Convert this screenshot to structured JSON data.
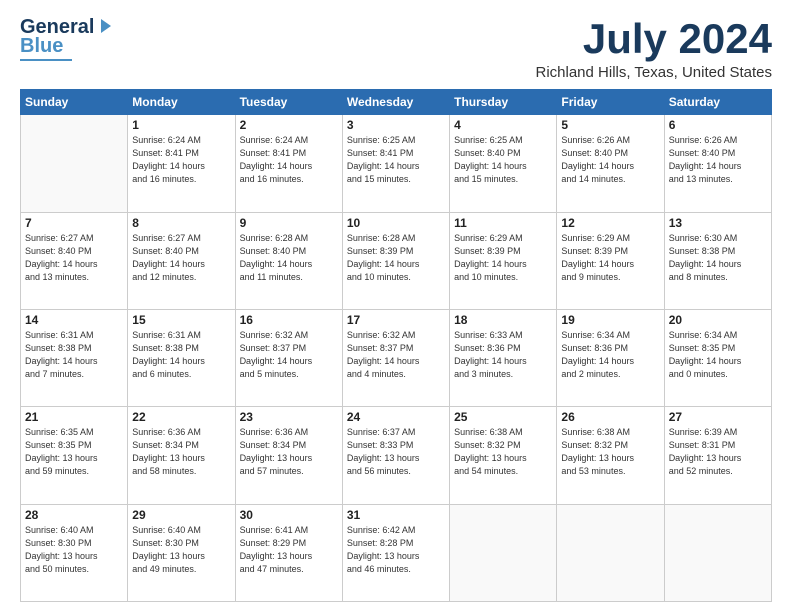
{
  "header": {
    "logo_line1": "General",
    "logo_line2": "Blue",
    "month": "July 2024",
    "location": "Richland Hills, Texas, United States"
  },
  "weekdays": [
    "Sunday",
    "Monday",
    "Tuesday",
    "Wednesday",
    "Thursday",
    "Friday",
    "Saturday"
  ],
  "weeks": [
    [
      {
        "day": "",
        "info": ""
      },
      {
        "day": "1",
        "info": "Sunrise: 6:24 AM\nSunset: 8:41 PM\nDaylight: 14 hours\nand 16 minutes."
      },
      {
        "day": "2",
        "info": "Sunrise: 6:24 AM\nSunset: 8:41 PM\nDaylight: 14 hours\nand 16 minutes."
      },
      {
        "day": "3",
        "info": "Sunrise: 6:25 AM\nSunset: 8:41 PM\nDaylight: 14 hours\nand 15 minutes."
      },
      {
        "day": "4",
        "info": "Sunrise: 6:25 AM\nSunset: 8:40 PM\nDaylight: 14 hours\nand 15 minutes."
      },
      {
        "day": "5",
        "info": "Sunrise: 6:26 AM\nSunset: 8:40 PM\nDaylight: 14 hours\nand 14 minutes."
      },
      {
        "day": "6",
        "info": "Sunrise: 6:26 AM\nSunset: 8:40 PM\nDaylight: 14 hours\nand 13 minutes."
      }
    ],
    [
      {
        "day": "7",
        "info": "Sunrise: 6:27 AM\nSunset: 8:40 PM\nDaylight: 14 hours\nand 13 minutes."
      },
      {
        "day": "8",
        "info": "Sunrise: 6:27 AM\nSunset: 8:40 PM\nDaylight: 14 hours\nand 12 minutes."
      },
      {
        "day": "9",
        "info": "Sunrise: 6:28 AM\nSunset: 8:40 PM\nDaylight: 14 hours\nand 11 minutes."
      },
      {
        "day": "10",
        "info": "Sunrise: 6:28 AM\nSunset: 8:39 PM\nDaylight: 14 hours\nand 10 minutes."
      },
      {
        "day": "11",
        "info": "Sunrise: 6:29 AM\nSunset: 8:39 PM\nDaylight: 14 hours\nand 10 minutes."
      },
      {
        "day": "12",
        "info": "Sunrise: 6:29 AM\nSunset: 8:39 PM\nDaylight: 14 hours\nand 9 minutes."
      },
      {
        "day": "13",
        "info": "Sunrise: 6:30 AM\nSunset: 8:38 PM\nDaylight: 14 hours\nand 8 minutes."
      }
    ],
    [
      {
        "day": "14",
        "info": "Sunrise: 6:31 AM\nSunset: 8:38 PM\nDaylight: 14 hours\nand 7 minutes."
      },
      {
        "day": "15",
        "info": "Sunrise: 6:31 AM\nSunset: 8:38 PM\nDaylight: 14 hours\nand 6 minutes."
      },
      {
        "day": "16",
        "info": "Sunrise: 6:32 AM\nSunset: 8:37 PM\nDaylight: 14 hours\nand 5 minutes."
      },
      {
        "day": "17",
        "info": "Sunrise: 6:32 AM\nSunset: 8:37 PM\nDaylight: 14 hours\nand 4 minutes."
      },
      {
        "day": "18",
        "info": "Sunrise: 6:33 AM\nSunset: 8:36 PM\nDaylight: 14 hours\nand 3 minutes."
      },
      {
        "day": "19",
        "info": "Sunrise: 6:34 AM\nSunset: 8:36 PM\nDaylight: 14 hours\nand 2 minutes."
      },
      {
        "day": "20",
        "info": "Sunrise: 6:34 AM\nSunset: 8:35 PM\nDaylight: 14 hours\nand 0 minutes."
      }
    ],
    [
      {
        "day": "21",
        "info": "Sunrise: 6:35 AM\nSunset: 8:35 PM\nDaylight: 13 hours\nand 59 minutes."
      },
      {
        "day": "22",
        "info": "Sunrise: 6:36 AM\nSunset: 8:34 PM\nDaylight: 13 hours\nand 58 minutes."
      },
      {
        "day": "23",
        "info": "Sunrise: 6:36 AM\nSunset: 8:34 PM\nDaylight: 13 hours\nand 57 minutes."
      },
      {
        "day": "24",
        "info": "Sunrise: 6:37 AM\nSunset: 8:33 PM\nDaylight: 13 hours\nand 56 minutes."
      },
      {
        "day": "25",
        "info": "Sunrise: 6:38 AM\nSunset: 8:32 PM\nDaylight: 13 hours\nand 54 minutes."
      },
      {
        "day": "26",
        "info": "Sunrise: 6:38 AM\nSunset: 8:32 PM\nDaylight: 13 hours\nand 53 minutes."
      },
      {
        "day": "27",
        "info": "Sunrise: 6:39 AM\nSunset: 8:31 PM\nDaylight: 13 hours\nand 52 minutes."
      }
    ],
    [
      {
        "day": "28",
        "info": "Sunrise: 6:40 AM\nSunset: 8:30 PM\nDaylight: 13 hours\nand 50 minutes."
      },
      {
        "day": "29",
        "info": "Sunrise: 6:40 AM\nSunset: 8:30 PM\nDaylight: 13 hours\nand 49 minutes."
      },
      {
        "day": "30",
        "info": "Sunrise: 6:41 AM\nSunset: 8:29 PM\nDaylight: 13 hours\nand 47 minutes."
      },
      {
        "day": "31",
        "info": "Sunrise: 6:42 AM\nSunset: 8:28 PM\nDaylight: 13 hours\nand 46 minutes."
      },
      {
        "day": "",
        "info": ""
      },
      {
        "day": "",
        "info": ""
      },
      {
        "day": "",
        "info": ""
      }
    ]
  ]
}
